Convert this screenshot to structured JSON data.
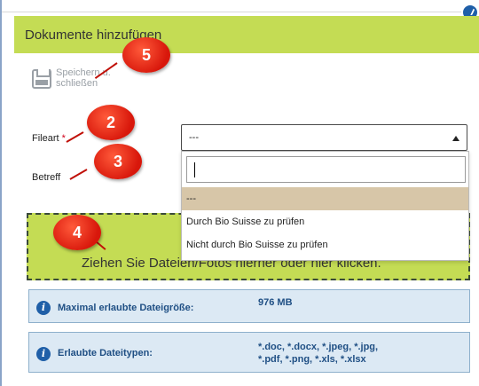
{
  "dialog": {
    "title": "Dokumente hinzufügen"
  },
  "toolbar": {
    "save_label_line1": "Speichern u.",
    "save_label_line2": "schließen"
  },
  "form": {
    "fileart_label": "Fileart",
    "required_marker": "*",
    "betreff_label": "Betreff",
    "select_value": "---"
  },
  "dropdown": {
    "search_value": "",
    "options": [
      {
        "label": "---",
        "selected": true
      },
      {
        "label": "Durch Bio Suisse zu prüfen",
        "selected": false
      },
      {
        "label": "Nicht durch Bio Suisse zu prüfen",
        "selected": false
      }
    ]
  },
  "dropzone": {
    "text": "Ziehen Sie Dateien/Fotos hierher oder hier klicken."
  },
  "info": {
    "max_size_label": "Maximal erlaubte Dateigröße:",
    "max_size_value": "976 MB",
    "types_label": "Erlaubte Dateitypen:",
    "types_value_line1": "*.doc, *.docx, *.jpeg, *.jpg,",
    "types_value_line2": "*.pdf, *.png, *.xls, *.xlsx"
  },
  "annotations": [
    {
      "number": "5"
    },
    {
      "number": "2"
    },
    {
      "number": "3"
    },
    {
      "number": "4"
    }
  ],
  "colors": {
    "header_bg": "#c4dc54",
    "badge": "#d8170b",
    "info_bg": "#dce9f4",
    "selected_option": "#d7c6a8"
  }
}
